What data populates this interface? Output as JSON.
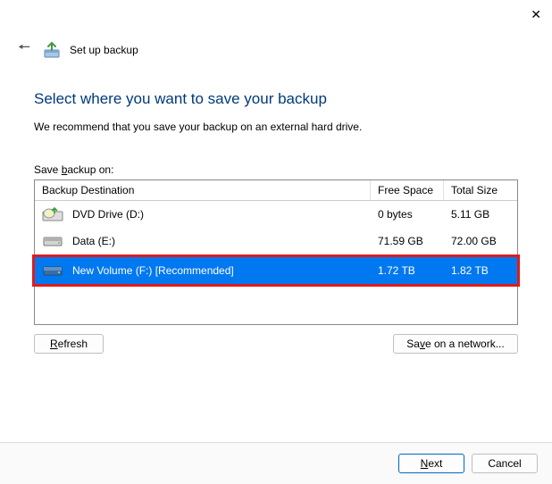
{
  "window": {
    "title": "Set up backup"
  },
  "main": {
    "heading": "Select where you want to save your backup",
    "subtext": "We recommend that you save your backup on an external hard drive.",
    "prompt_pre": "Save ",
    "prompt_key": "b",
    "prompt_post": "ackup on:"
  },
  "columns": {
    "dest": "Backup Destination",
    "free": "Free Space",
    "total": "Total Size"
  },
  "drives": [
    {
      "icon": "dvd",
      "name": "DVD Drive (D:)",
      "free": "0 bytes",
      "total": "5.11 GB",
      "selected": false
    },
    {
      "icon": "hdd",
      "name": "Data (E:)",
      "free": "71.59 GB",
      "total": "72.00 GB",
      "selected": false
    },
    {
      "icon": "hdd",
      "name": "New Volume (F:) [Recommended]",
      "free": "1.72 TB",
      "total": "1.82 TB",
      "selected": true
    }
  ],
  "buttons": {
    "refresh_key": "R",
    "refresh_rest": "efresh",
    "save_network_pre": "Sa",
    "save_network_key": "v",
    "save_network_post": "e on a network...",
    "next_key": "N",
    "next_rest": "ext",
    "cancel": "Cancel"
  }
}
